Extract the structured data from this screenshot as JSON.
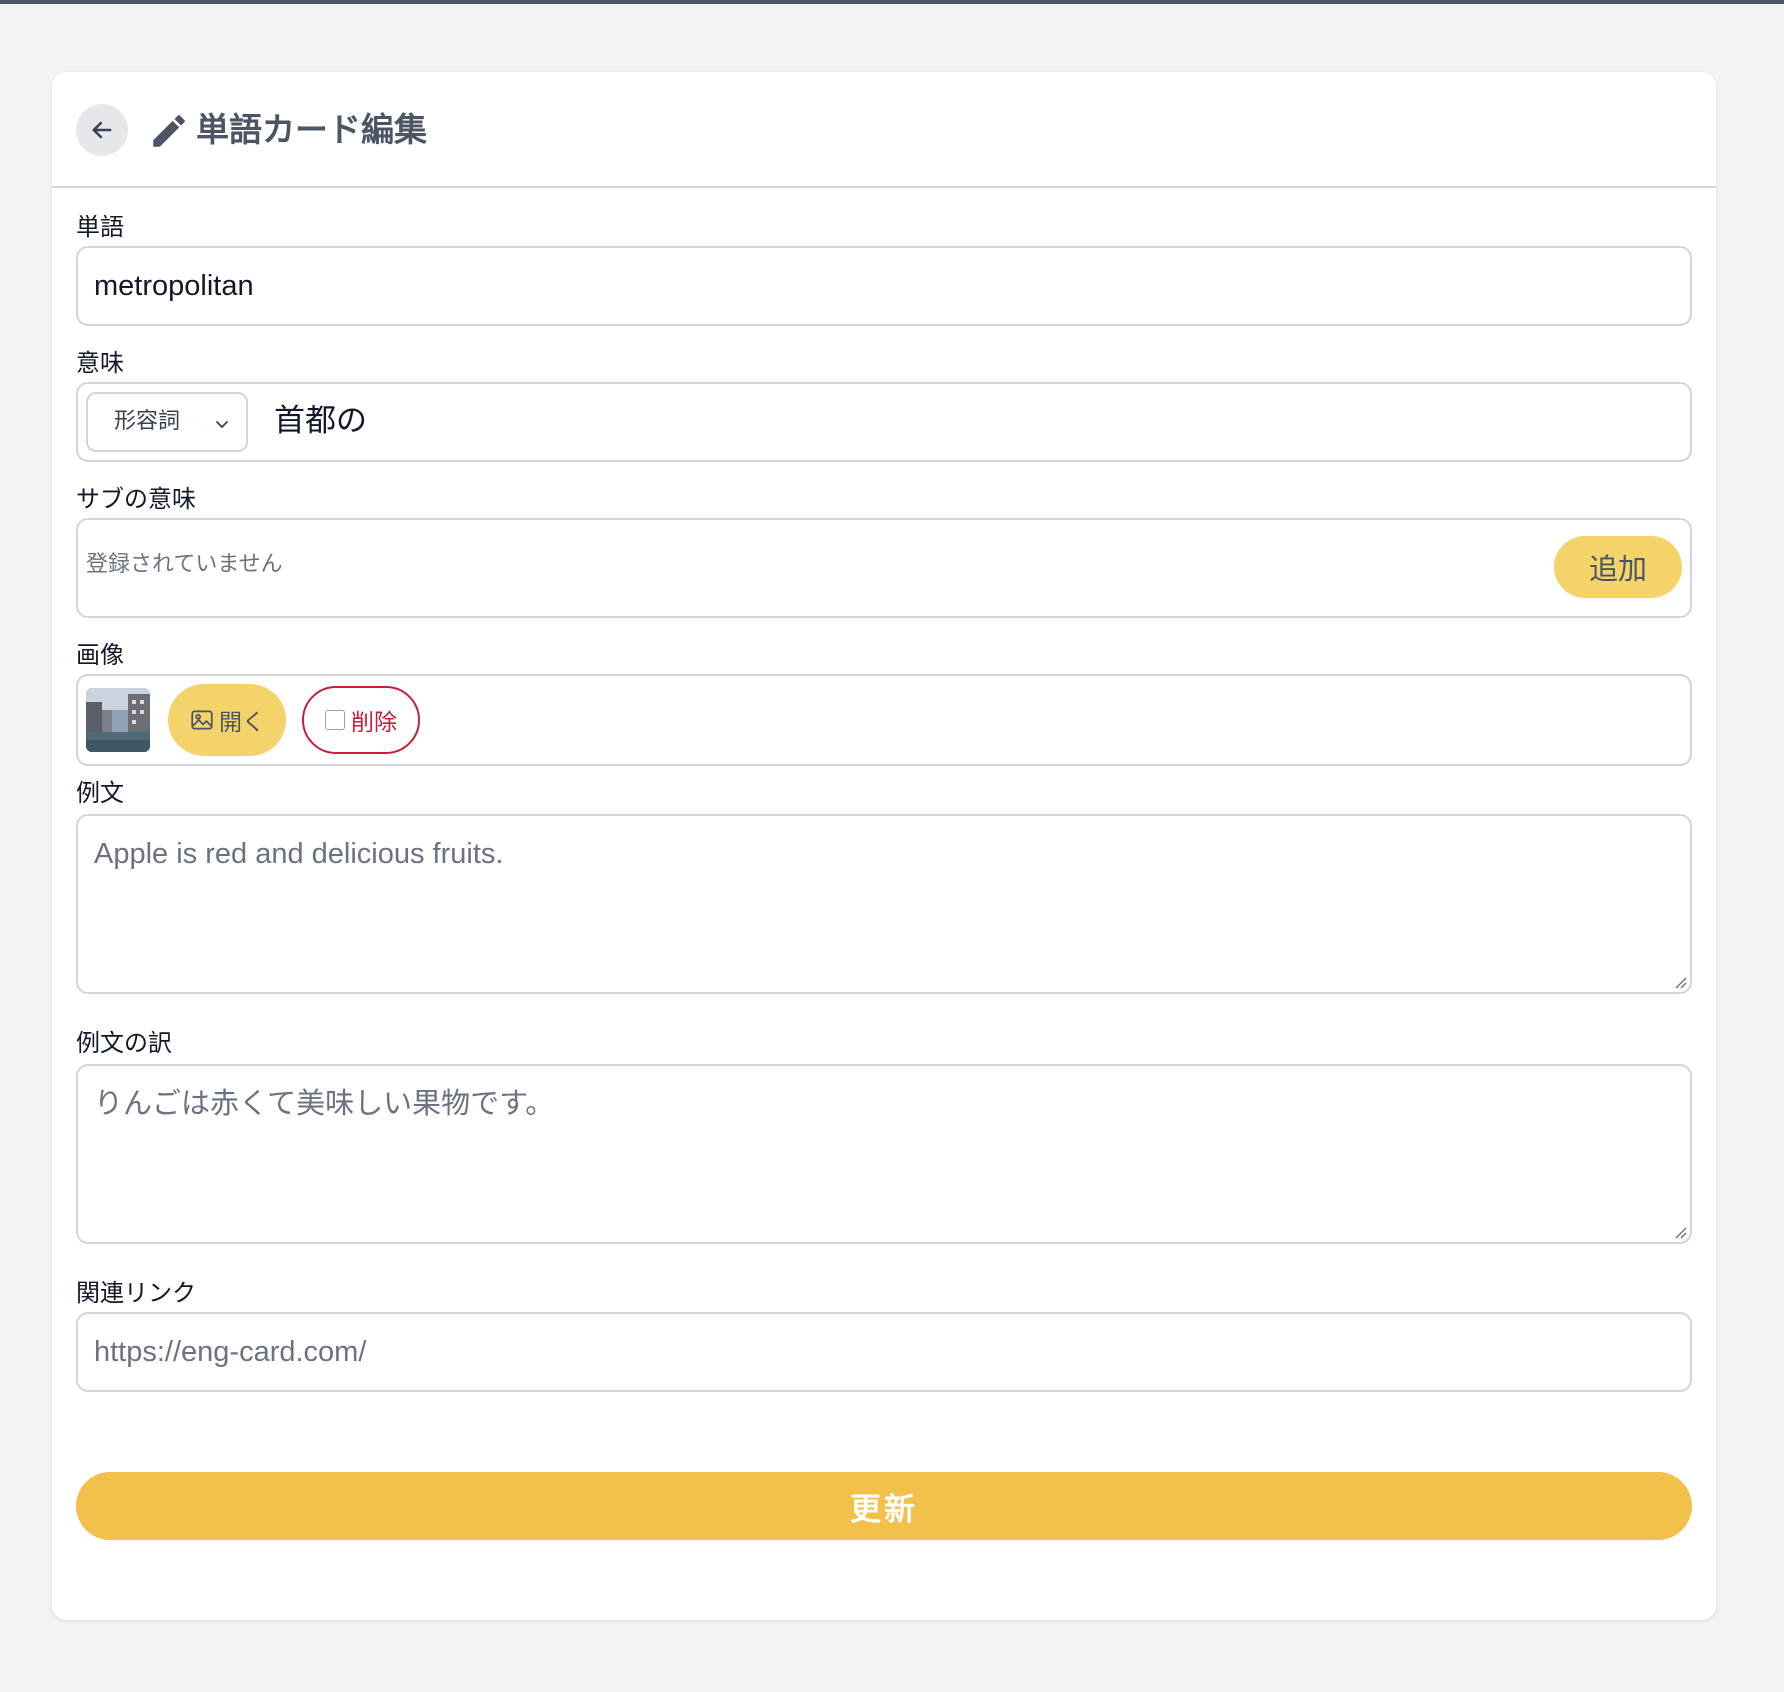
{
  "header": {
    "title": "単語カード編集",
    "back_icon": "arrow-left-icon",
    "title_icon": "pencil-icon"
  },
  "form": {
    "word": {
      "label": "単語",
      "value": "metropolitan"
    },
    "meaning": {
      "label": "意味",
      "part_of_speech": "形容詞",
      "value": "首都の"
    },
    "sub_meaning": {
      "label": "サブの意味",
      "empty_text": "登録されていません",
      "add_label": "追加"
    },
    "image": {
      "label": "画像",
      "open_label": "開く",
      "delete_label": "削除"
    },
    "example": {
      "label": "例文",
      "placeholder": "Apple is red and delicious fruits."
    },
    "example_translation": {
      "label": "例文の訳",
      "placeholder": "りんごは赤くて美味しい果物です。"
    },
    "related_link": {
      "label": "関連リンク",
      "placeholder": "https://eng-card.com/"
    },
    "submit_label": "更新"
  },
  "colors": {
    "accent": "#f2c04b",
    "accent_light": "#f4d46a",
    "danger": "#c81e3a",
    "background": "#f2f3f5"
  }
}
